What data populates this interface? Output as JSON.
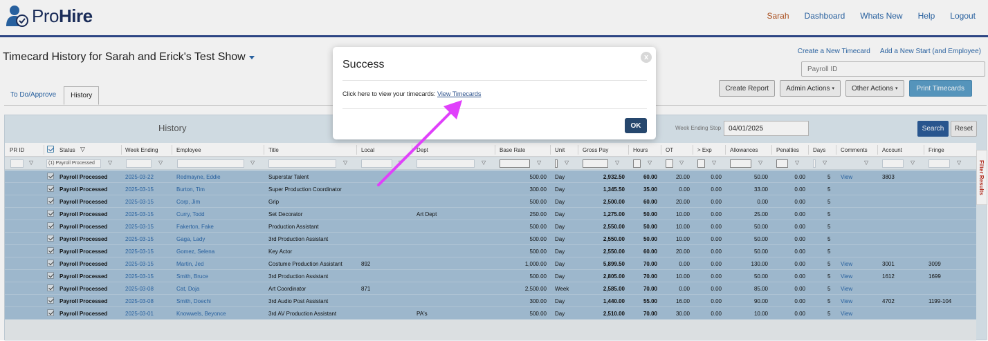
{
  "app": {
    "logo_pre": "Pro",
    "logo_bold": "Hire",
    "nav": {
      "user": "Sarah",
      "dashboard": "Dashboard",
      "whats_new": "Whats New",
      "help": "Help",
      "logout": "Logout"
    }
  },
  "page": {
    "title": "Timecard History for Sarah and Erick's Test Show",
    "create_timecard": "Create a New Timecard",
    "add_start": "Add a New Start (and Employee)",
    "payroll_placeholder": "Payroll ID",
    "buttons": {
      "create_report": "Create Report",
      "admin_actions": "Admin Actions",
      "other_actions": "Other Actions",
      "print": "Print Timecards"
    },
    "tabs": [
      "To Do/Approve",
      "History"
    ]
  },
  "panel": {
    "title": "History",
    "week_ending_stop_label": "Week Ending Stop",
    "week_ending_stop_value": "04/01/2025",
    "search": "Search",
    "reset": "Reset",
    "filter_results": "Filter Results",
    "status_filter_value": "(1) Payroll Processed"
  },
  "grid": {
    "columns": {
      "pr_id": "PR ID",
      "status": "Status",
      "week_ending": "Week Ending",
      "employee": "Employee",
      "title": "Title",
      "local": "Local",
      "dept": "Dept",
      "base_rate": "Base Rate",
      "unit": "Unit",
      "gross_pay": "Gross Pay",
      "hours": "Hours",
      "ot": "OT",
      "exp": "> Exp",
      "allowances": "Allowances",
      "penalties": "Penalties",
      "days": "Days",
      "comments": "Comments",
      "account": "Account",
      "fringe": "Fringe"
    },
    "rows": [
      {
        "status": "Payroll Processed",
        "week": "2025-03-22",
        "employee": "Redmayne, Eddie",
        "title": "Superstar Talent",
        "local": "",
        "dept": "",
        "rate": "500.00",
        "unit": "Day",
        "gross": "2,932.50",
        "hours": "60.00",
        "ot": "20.00",
        "exp": "0.00",
        "allow": "50.00",
        "pen": "0.00",
        "days": "5",
        "comments": "View",
        "account": "3803",
        "fringe": ""
      },
      {
        "status": "Payroll Processed",
        "week": "2025-03-15",
        "employee": "Burton, Tim",
        "title": "Super Production Coordinator",
        "local": "",
        "dept": "",
        "rate": "300.00",
        "unit": "Day",
        "gross": "1,345.50",
        "hours": "35.00",
        "ot": "0.00",
        "exp": "0.00",
        "allow": "33.00",
        "pen": "0.00",
        "days": "5",
        "comments": "",
        "account": "",
        "fringe": ""
      },
      {
        "status": "Payroll Processed",
        "week": "2025-03-15",
        "employee": "Corp, Jim",
        "title": "Grip",
        "local": "",
        "dept": "",
        "rate": "500.00",
        "unit": "Day",
        "gross": "2,500.00",
        "hours": "60.00",
        "ot": "20.00",
        "exp": "0.00",
        "allow": "0.00",
        "pen": "0.00",
        "days": "5",
        "comments": "",
        "account": "",
        "fringe": ""
      },
      {
        "status": "Payroll Processed",
        "week": "2025-03-15",
        "employee": "Curry, Todd",
        "title": "Set Decorator",
        "local": "",
        "dept": "Art Dept",
        "rate": "250.00",
        "unit": "Day",
        "gross": "1,275.00",
        "hours": "50.00",
        "ot": "10.00",
        "exp": "0.00",
        "allow": "25.00",
        "pen": "0.00",
        "days": "5",
        "comments": "",
        "account": "",
        "fringe": ""
      },
      {
        "status": "Payroll Processed",
        "week": "2025-03-15",
        "employee": "Fakerton, Fake",
        "title": "Production Assistant",
        "local": "",
        "dept": "",
        "rate": "500.00",
        "unit": "Day",
        "gross": "2,550.00",
        "hours": "50.00",
        "ot": "10.00",
        "exp": "0.00",
        "allow": "50.00",
        "pen": "0.00",
        "days": "5",
        "comments": "",
        "account": "",
        "fringe": ""
      },
      {
        "status": "Payroll Processed",
        "week": "2025-03-15",
        "employee": "Gaga, Lady",
        "title": "3rd Production Assistant",
        "local": "",
        "dept": "",
        "rate": "500.00",
        "unit": "Day",
        "gross": "2,550.00",
        "hours": "50.00",
        "ot": "10.00",
        "exp": "0.00",
        "allow": "50.00",
        "pen": "0.00",
        "days": "5",
        "comments": "",
        "account": "",
        "fringe": ""
      },
      {
        "status": "Payroll Processed",
        "week": "2025-03-15",
        "employee": "Gomez, Selena",
        "title": "Key Actor",
        "local": "",
        "dept": "",
        "rate": "500.00",
        "unit": "Day",
        "gross": "2,550.00",
        "hours": "60.00",
        "ot": "20.00",
        "exp": "0.00",
        "allow": "50.00",
        "pen": "0.00",
        "days": "5",
        "comments": "",
        "account": "",
        "fringe": ""
      },
      {
        "status": "Payroll Processed",
        "week": "2025-03-15",
        "employee": "Martin, Jed",
        "title": "Costume Production Assistant",
        "local": "892",
        "dept": "",
        "rate": "1,000.00",
        "unit": "Day",
        "gross": "5,899.50",
        "hours": "70.00",
        "ot": "0.00",
        "exp": "0.00",
        "allow": "130.00",
        "pen": "0.00",
        "days": "5",
        "comments": "View",
        "account": "3001",
        "fringe": "3099"
      },
      {
        "status": "Payroll Processed",
        "week": "2025-03-15",
        "employee": "Smith, Bruce",
        "title": "3rd Production Assistant",
        "local": "",
        "dept": "",
        "rate": "500.00",
        "unit": "Day",
        "gross": "2,805.00",
        "hours": "70.00",
        "ot": "10.00",
        "exp": "0.00",
        "allow": "50.00",
        "pen": "0.00",
        "days": "5",
        "comments": "View",
        "account": "1612",
        "fringe": "1699"
      },
      {
        "status": "Payroll Processed",
        "week": "2025-03-08",
        "employee": "Cat, Doja",
        "title": "Art Coordinator",
        "local": "871",
        "dept": "",
        "rate": "2,500.00",
        "unit": "Week",
        "gross": "2,585.00",
        "hours": "70.00",
        "ot": "0.00",
        "exp": "0.00",
        "allow": "85.00",
        "pen": "0.00",
        "days": "5",
        "comments": "View",
        "account": "",
        "fringe": ""
      },
      {
        "status": "Payroll Processed",
        "week": "2025-03-08",
        "employee": "Smith, Doechi",
        "title": "3rd Audio Post Assistant",
        "local": "",
        "dept": "",
        "rate": "300.00",
        "unit": "Day",
        "gross": "1,440.00",
        "hours": "55.00",
        "ot": "16.00",
        "exp": "0.00",
        "allow": "90.00",
        "pen": "0.00",
        "days": "5",
        "comments": "View",
        "account": "4702",
        "fringe": "1199-104"
      },
      {
        "status": "Payroll Processed",
        "week": "2025-03-01",
        "employee": "Knowwels, Beyonce",
        "title": "3rd AV Production Assistant",
        "local": "",
        "dept": "PA's",
        "rate": "500.00",
        "unit": "Day",
        "gross": "2,510.00",
        "hours": "70.00",
        "ot": "30.00",
        "exp": "0.00",
        "allow": "10.00",
        "pen": "0.00",
        "days": "5",
        "comments": "View",
        "account": "",
        "fringe": ""
      }
    ]
  },
  "modal": {
    "title": "Success",
    "close": "x",
    "body_text": "Click here to view your timecards: ",
    "link_text": "View Timecards",
    "ok": "OK"
  },
  "colors": {
    "brand": "#1c2f5e",
    "link": "#2a66a8",
    "row_highlight": "#a7c3d9",
    "annotation_arrow": "#e040fb"
  }
}
